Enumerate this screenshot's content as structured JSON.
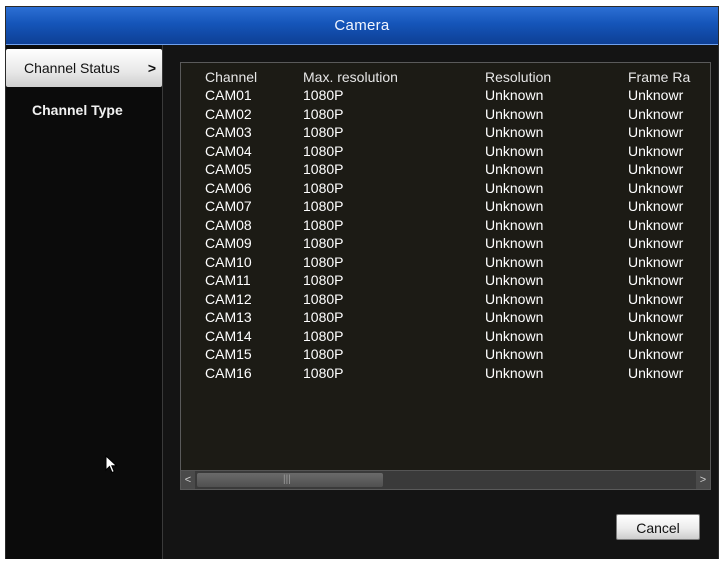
{
  "window": {
    "title": "Camera"
  },
  "sidebar": {
    "items": [
      {
        "label": "Channel Status",
        "chevron": ">"
      },
      {
        "label": "Channel Type"
      }
    ]
  },
  "table": {
    "columns": [
      "Channel",
      "Max. resolution",
      "Resolution",
      "Frame Ra"
    ],
    "rows": [
      [
        "CAM01",
        "1080P",
        "Unknown",
        "Unknowr"
      ],
      [
        "CAM02",
        "1080P",
        "Unknown",
        "Unknowr"
      ],
      [
        "CAM03",
        "1080P",
        "Unknown",
        "Unknowr"
      ],
      [
        "CAM04",
        "1080P",
        "Unknown",
        "Unknowr"
      ],
      [
        "CAM05",
        "1080P",
        "Unknown",
        "Unknowr"
      ],
      [
        "CAM06",
        "1080P",
        "Unknown",
        "Unknowr"
      ],
      [
        "CAM07",
        "1080P",
        "Unknown",
        "Unknowr"
      ],
      [
        "CAM08",
        "1080P",
        "Unknown",
        "Unknowr"
      ],
      [
        "CAM09",
        "1080P",
        "Unknown",
        "Unknowr"
      ],
      [
        "CAM10",
        "1080P",
        "Unknown",
        "Unknowr"
      ],
      [
        "CAM11",
        "1080P",
        "Unknown",
        "Unknowr"
      ],
      [
        "CAM12",
        "1080P",
        "Unknown",
        "Unknowr"
      ],
      [
        "CAM13",
        "1080P",
        "Unknown",
        "Unknowr"
      ],
      [
        "CAM14",
        "1080P",
        "Unknown",
        "Unknowr"
      ],
      [
        "CAM15",
        "1080P",
        "Unknown",
        "Unknowr"
      ],
      [
        "CAM16",
        "1080P",
        "Unknown",
        "Unknowr"
      ]
    ]
  },
  "scrollbar": {
    "left_arrow": "<",
    "right_arrow": ">",
    "grip": "|||"
  },
  "buttons": {
    "cancel": "Cancel"
  },
  "icons": {
    "cursor": "mouse-pointer-icon"
  },
  "colors": {
    "title_bar": "#1555b9",
    "background": "#0b0b0b",
    "table_bg": "#1c1b15",
    "text": "#ffffff"
  }
}
